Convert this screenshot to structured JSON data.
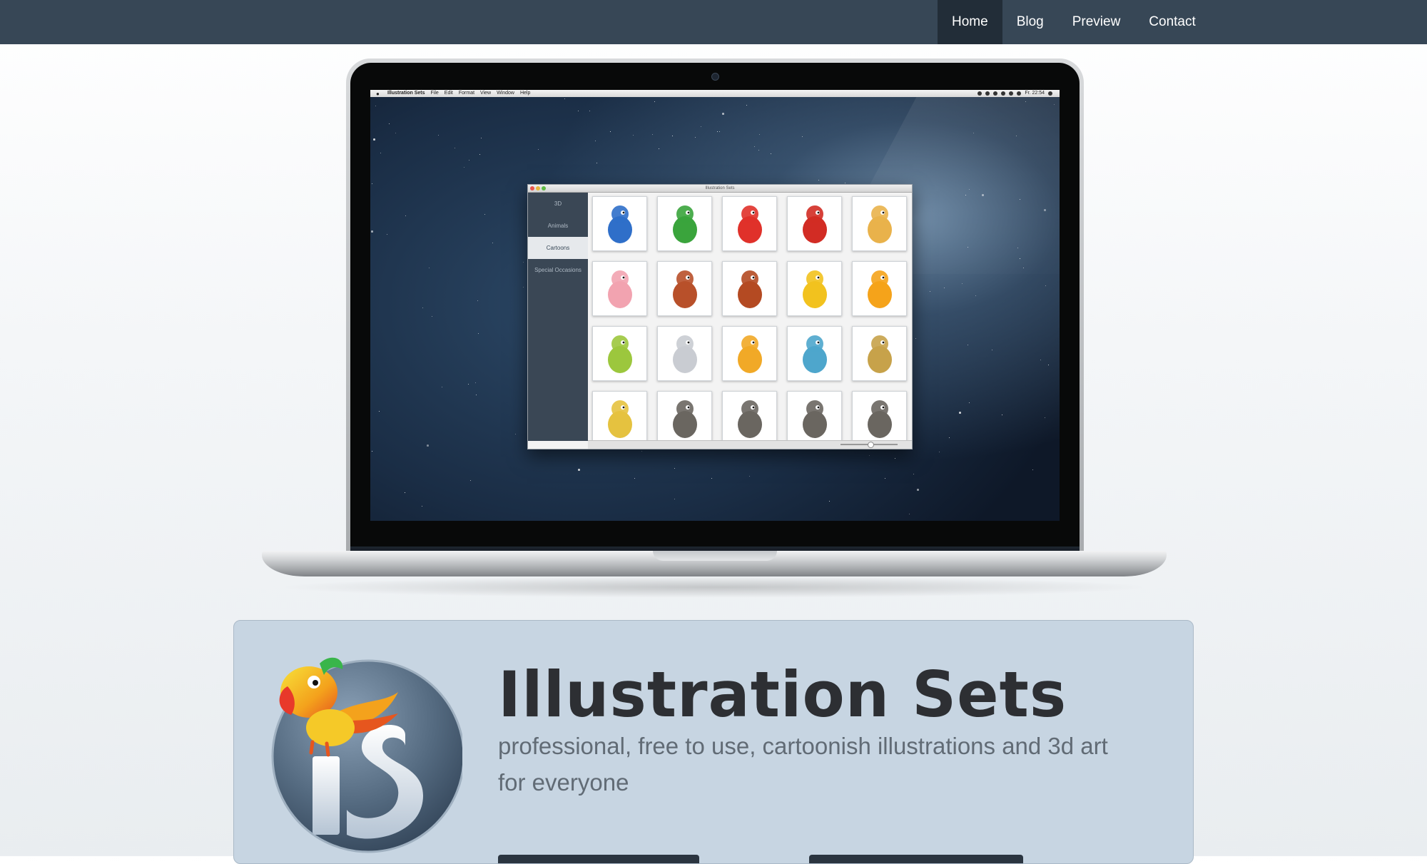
{
  "nav": {
    "items": [
      {
        "label": "Home",
        "active": true
      },
      {
        "label": "Blog",
        "active": false
      },
      {
        "label": "Preview",
        "active": false
      },
      {
        "label": "Contact",
        "active": false
      }
    ]
  },
  "screen": {
    "menubar": {
      "menus": [
        "Illustration Sets",
        "File",
        "Edit",
        "Format",
        "View",
        "Window",
        "Help"
      ],
      "clock": "Fr. 22:54"
    },
    "app_window": {
      "title": "Illustration Sets",
      "sidebar": [
        {
          "label": "3D",
          "selected": false
        },
        {
          "label": "Animals",
          "selected": false
        },
        {
          "label": "Cartoons",
          "selected": true
        },
        {
          "label": "Special Occasions",
          "selected": false
        }
      ],
      "thumbnails": [
        {
          "icon": "parrot-icon",
          "color": "#2f6fc9"
        },
        {
          "icon": "frog-icon",
          "color": "#3aa43c"
        },
        {
          "icon": "lobster-icon",
          "color": "#e0312a"
        },
        {
          "icon": "ladybug-icon",
          "color": "#d22c24"
        },
        {
          "icon": "snail-icon",
          "color": "#e9b24b"
        },
        {
          "icon": "pig-icon",
          "color": "#f2a3b0"
        },
        {
          "icon": "ant-guitar-icon",
          "color": "#b8502a"
        },
        {
          "icon": "ant-briefcase-icon",
          "color": "#b44a22"
        },
        {
          "icon": "bird-icon",
          "color": "#f2c21e"
        },
        {
          "icon": "fish-icon",
          "color": "#f5a31a"
        },
        {
          "icon": "turtle-icon",
          "color": "#9cc73d"
        },
        {
          "icon": "elephant-icon",
          "color": "#c9ccd2"
        },
        {
          "icon": "leopard-icon",
          "color": "#f1a927"
        },
        {
          "icon": "bee-girl-icon",
          "color": "#4ea6cc"
        },
        {
          "icon": "girl-icon",
          "color": "#c7a24a"
        },
        {
          "icon": "bee-icon",
          "color": "#e5c23f"
        },
        {
          "icon": "rat-icon",
          "color": "#6a6660"
        },
        {
          "icon": "rat-icon",
          "color": "#6a6660"
        },
        {
          "icon": "rat-icon",
          "color": "#6a6660"
        },
        {
          "icon": "rat-icon",
          "color": "#6a6660"
        }
      ]
    }
  },
  "hero": {
    "title": "Illustration Sets",
    "subtitle": "professional, free to use, cartoonish illustrations and 3d art for everyone",
    "logo_letters": "iS"
  },
  "colors": {
    "nav_bg": "#374756",
    "nav_active": "#222d38",
    "hero_bg": "#c7d5e2",
    "title": "#2d2f33",
    "subtitle": "#616b75"
  }
}
